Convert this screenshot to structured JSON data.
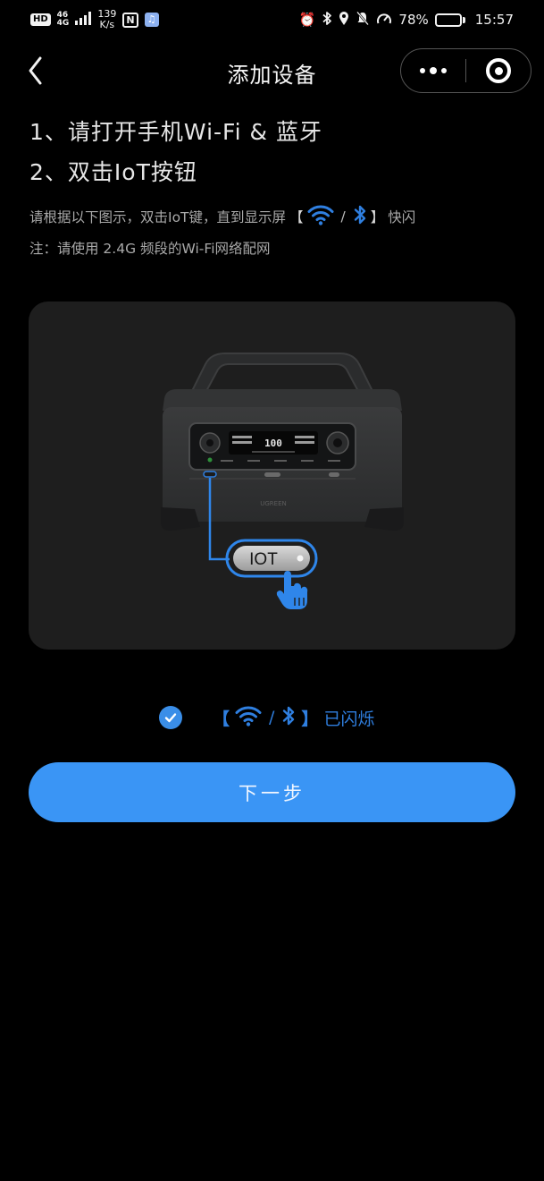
{
  "status_bar": {
    "hd": "HD",
    "net_top": "46",
    "net_bottom": "4G",
    "speed_value": "139",
    "speed_unit": "K/s",
    "nfc": "N",
    "battery_percent": "78%",
    "battery_level": 0.78,
    "time": "15:57"
  },
  "nav": {
    "title": "添加设备"
  },
  "instructions": {
    "step1": "1、请打开手机Wi-Fi & 蓝牙",
    "step2": "2、双击IoT按钮",
    "tip1_before": "请根据以下图示，双击IoT键，直到显示屏",
    "bracket_open": "【",
    "bracket_close": "】",
    "slash": "/",
    "tip1_after": "快闪",
    "tip2": "注：请使用 2.4G 频段的Wi-Fi网络配网"
  },
  "illustration": {
    "iot_label": "IOT",
    "display_value": "100",
    "brand": "UGREEN"
  },
  "confirm": {
    "text": "已闪烁",
    "checked": true
  },
  "next_button": {
    "label": "下一步"
  },
  "colors": {
    "background": "#000000",
    "accent": "#3a95f5",
    "icon_blue": "#2f7fe0",
    "card": "#1e1e1e"
  }
}
